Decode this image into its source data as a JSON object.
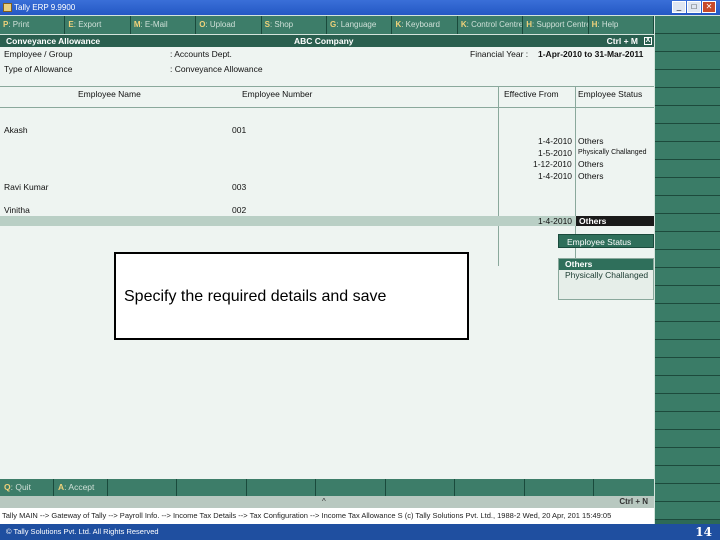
{
  "window": {
    "title": "Tally ERP 9.9900",
    "min": "_",
    "max": "□",
    "close": "✕"
  },
  "top_menu": [
    {
      "key": "P",
      "label": ": Print"
    },
    {
      "key": "E",
      "label": ": Export"
    },
    {
      "key": "M",
      "label": ": E-Mail"
    },
    {
      "key": "O",
      "label": ": Upload"
    },
    {
      "key": "S",
      "label": ": Shop"
    },
    {
      "key": "G",
      "label": ": Language"
    },
    {
      "key": "K",
      "label": ": Keyboard"
    },
    {
      "key": "K",
      "label": ": Control Centre"
    },
    {
      "key": "H",
      "label": ": Support Centre"
    },
    {
      "key": "H",
      "label": ": Help"
    }
  ],
  "header": {
    "screen": "Conveyance Allowance",
    "company": "ABC Company",
    "shortcut": "Ctrl + M",
    "close": "X"
  },
  "form": {
    "group_label": "Employee / Group",
    "group_value": ": Accounts Dept.",
    "allowance_label": "Type of Allowance",
    "allowance_value": ": Conveyance Allowance",
    "fy_label": "Financial Year :",
    "fy_value": "1-Apr-2010 to 31-Mar-2011"
  },
  "columns": {
    "name": "Employee Name",
    "number": "Employee Number",
    "effective": "Effective From",
    "status": "Employee Status"
  },
  "rows": {
    "akash": {
      "name": "Akash",
      "number": "001"
    },
    "ravi": {
      "name": "Ravi Kumar",
      "number": "003"
    },
    "vinitha": {
      "name": "Vinitha",
      "number": "002"
    }
  },
  "entries": [
    {
      "date": "1-4-2010",
      "status": "Others"
    },
    {
      "date": "1-5-2010",
      "status": "Physically Challanged"
    },
    {
      "date": "1-12-2010",
      "status": "Others"
    },
    {
      "date": "1-4-2010",
      "status": "Others"
    }
  ],
  "current_entry": {
    "date": "1-4-2010",
    "status": "Others"
  },
  "popup": {
    "title": "Employee Status",
    "options": [
      "Others",
      "Physically Challanged"
    ]
  },
  "callout": "Specify the required details and save",
  "bottom": {
    "quit_key": "Q",
    "quit_label": ": Quit",
    "accept_key": "A",
    "accept_label": ": Accept",
    "caret": "^",
    "ctrl_n": "Ctrl + N"
  },
  "path": "Tally MAIN --> Gateway of Tally --> Payroll Info. --> Income Tax Details --> Tax Configuration --> Income Tax Allowance S (c) Tally Solutions Pvt. Ltd., 1988-2 Wed, 20 Apr, 201 15:49:05",
  "footer": {
    "copyright": "© Tally Solutions Pvt. Ltd. All Rights Reserved",
    "page": "14"
  }
}
